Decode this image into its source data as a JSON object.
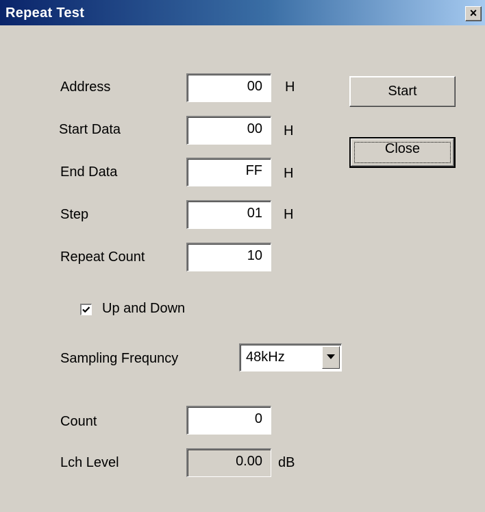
{
  "window": {
    "title": "Repeat Test",
    "close_glyph": "×"
  },
  "fields": {
    "address": {
      "label": "Address",
      "value": "00",
      "unit": "H"
    },
    "start_data": {
      "label": "Start Data",
      "value": "00",
      "unit": "H"
    },
    "end_data": {
      "label": "End Data",
      "value": "FF",
      "unit": "H"
    },
    "step": {
      "label": "Step",
      "value": "01",
      "unit": "H"
    },
    "repeat_count": {
      "label": "Repeat Count",
      "value": "10"
    }
  },
  "up_and_down": {
    "label": "Up and Down",
    "checked": true
  },
  "sampling": {
    "label": "Sampling Frequncy",
    "selected": "48kHz"
  },
  "count": {
    "label": "Count",
    "value": "0"
  },
  "lch_level": {
    "label": "Lch Level",
    "value": "0.00",
    "unit": "dB"
  },
  "buttons": {
    "start": "Start",
    "close": "Close"
  }
}
